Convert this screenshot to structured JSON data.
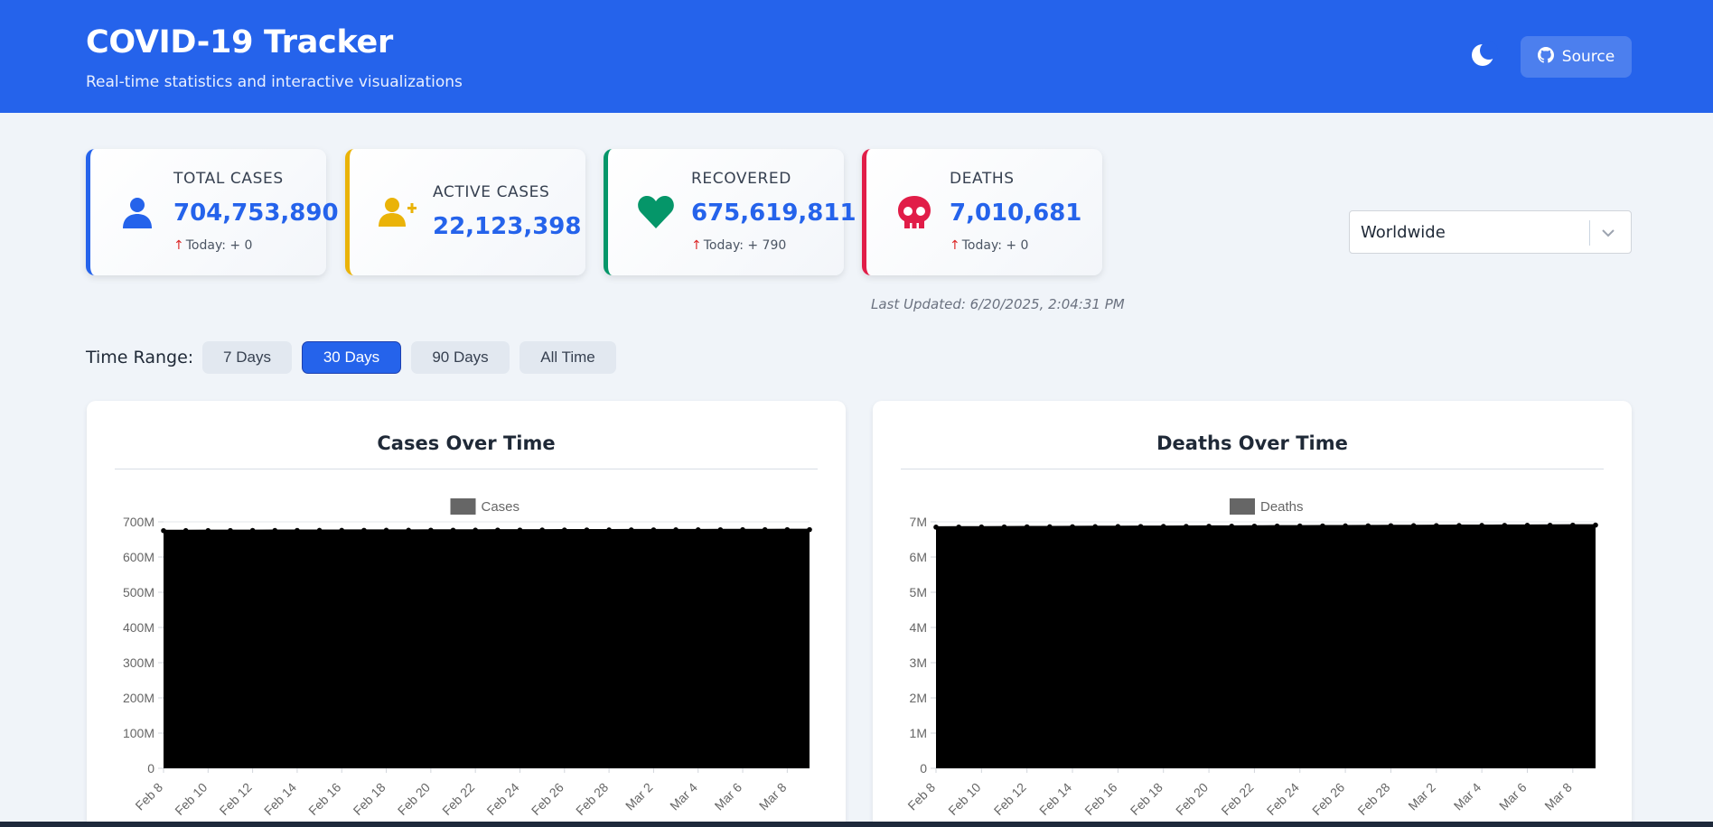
{
  "header": {
    "title": "COVID-19 Tracker",
    "subtitle": "Real-time statistics and interactive visualizations",
    "theme_icon": "moon-icon",
    "source_label": "Source",
    "source_icon": "github-icon"
  },
  "colors": {
    "primary": "#2563eb",
    "active": "#eab308",
    "recovered": "#059669",
    "deaths": "#e11d48",
    "up_arrow": "#dc2626"
  },
  "stats": [
    {
      "label": "TOTAL CASES",
      "value": "704,753,890",
      "today_prefix": "↑",
      "today": "Today: + 0",
      "icon": "user-icon"
    },
    {
      "label": "ACTIVE CASES",
      "value": "22,123,398",
      "icon": "user-plus-icon"
    },
    {
      "label": "RECOVERED",
      "value": "675,619,811",
      "today_prefix": "↑",
      "today": "Today: + 790",
      "icon": "heart-icon"
    },
    {
      "label": "DEATHS",
      "value": "7,010,681",
      "today_prefix": "↑",
      "today": "Today: + 0",
      "icon": "skull-icon"
    }
  ],
  "last_updated": "Last Updated: 6/20/2025, 2:04:31 PM",
  "country_select": {
    "value": "Worldwide",
    "icon": "chevron-down-icon"
  },
  "time_range": {
    "label": "Time Range:",
    "options": [
      "7 Days",
      "30 Days",
      "90 Days",
      "All Time"
    ],
    "selected": "30 Days"
  },
  "chart_data": [
    {
      "type": "area",
      "title": "Cases Over Time",
      "series": [
        {
          "name": "Cases",
          "values": [
            675000000,
            675100000,
            675200000,
            675300000,
            675400000,
            675500000,
            675600000,
            675700000,
            675800000,
            675900000,
            676000000,
            676100000,
            676200000,
            676300000,
            676400000,
            676500000,
            676600000,
            676700000,
            676800000,
            676900000,
            677000000,
            677100000,
            677200000,
            677300000,
            677400000,
            677500000,
            677600000,
            677700000,
            677800000,
            677900000
          ]
        }
      ],
      "x_tick_labels": [
        "Feb 8",
        "Feb 10",
        "Feb 12",
        "Feb 14",
        "Feb 16",
        "Feb 18",
        "Feb 20",
        "Feb 22",
        "Feb 24",
        "Feb 26",
        "Feb 28",
        "Mar 2",
        "Mar 4",
        "Mar 6",
        "Mar 8"
      ],
      "y_tick_labels": [
        "0",
        "100M",
        "200M",
        "300M",
        "400M",
        "500M",
        "600M",
        "700M"
      ],
      "ylim": [
        0,
        700000000
      ],
      "legend": "top-center",
      "fill_color": "#000000"
    },
    {
      "type": "area",
      "title": "Deaths Over Time",
      "series": [
        {
          "name": "Deaths",
          "values": [
            6850000,
            6852000,
            6854000,
            6856000,
            6858000,
            6860000,
            6862000,
            6864000,
            6866000,
            6868000,
            6870000,
            6872000,
            6874000,
            6876000,
            6878000,
            6880000,
            6882000,
            6884000,
            6886000,
            6888000,
            6890000,
            6892000,
            6894000,
            6896000,
            6898000,
            6900000,
            6902000,
            6904000,
            6906000,
            6908000
          ]
        }
      ],
      "x_tick_labels": [
        "Feb 8",
        "Feb 10",
        "Feb 12",
        "Feb 14",
        "Feb 16",
        "Feb 18",
        "Feb 20",
        "Feb 22",
        "Feb 24",
        "Feb 26",
        "Feb 28",
        "Mar 2",
        "Mar 4",
        "Mar 6",
        "Mar 8"
      ],
      "y_tick_labels": [
        "0",
        "1M",
        "2M",
        "3M",
        "4M",
        "5M",
        "6M",
        "7M"
      ],
      "ylim": [
        0,
        7000000
      ],
      "legend": "top-center",
      "fill_color": "#000000"
    }
  ]
}
